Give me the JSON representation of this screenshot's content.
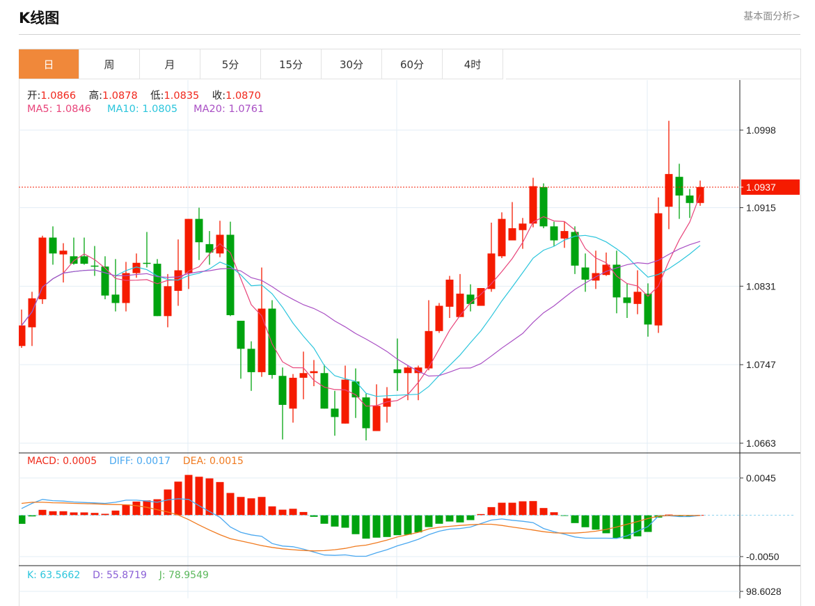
{
  "header": {
    "title": "K线图",
    "link": "基本面分析>"
  },
  "tabs": [
    {
      "label": "日",
      "active": true
    },
    {
      "label": "周"
    },
    {
      "label": "月"
    },
    {
      "label": "5分"
    },
    {
      "label": "15分"
    },
    {
      "label": "30分"
    },
    {
      "label": "60分"
    },
    {
      "label": "4时"
    }
  ],
  "ohlc_legend": {
    "open_label": "开:",
    "open": "1.0866",
    "high_label": "高:",
    "high": "1.0878",
    "low_label": "低:",
    "low": "1.0835",
    "close_label": "收:",
    "close": "1.0870"
  },
  "ma_legend": {
    "ma5_label": "MA5:",
    "ma5": "1.0846",
    "ma10_label": "MA10:",
    "ma10": "1.0805",
    "ma20_label": "MA20:",
    "ma20": "1.0761"
  },
  "macd_legend": {
    "macd": "MACD: 0.0005",
    "diff": "DIFF: 0.0017",
    "dea": "DEA: 0.0015"
  },
  "kdj_legend": {
    "k": "K: 63.5662",
    "d": "D: 55.8719",
    "j": "J: 78.9549"
  },
  "colors": {
    "up": "#f51b00",
    "down": "#00a30f",
    "ma5": "#e8447a",
    "ma10": "#2bc5dc",
    "ma20": "#a94fc4",
    "diff": "#4aa8f0",
    "dea": "#f07a1f",
    "accent": "#f0883a"
  },
  "chart_data": {
    "type": "candlestick",
    "price_axis": {
      "ticks": [
        "1.0998",
        "1.0915",
        "1.0831",
        "1.0747",
        "1.0663"
      ],
      "range": [
        1.0663,
        1.0998
      ]
    },
    "last_price": "1.0937",
    "candles_ohlc": [
      [
        1.0767,
        1.0806,
        1.0765,
        1.0789
      ],
      [
        1.0787,
        1.0825,
        1.0767,
        1.0818
      ],
      [
        1.0817,
        1.0885,
        1.0812,
        1.0883
      ],
      [
        1.0883,
        1.0895,
        1.0854,
        1.0866
      ],
      [
        1.0865,
        1.0877,
        1.0835,
        1.0869
      ],
      [
        1.0863,
        1.0883,
        1.0854,
        1.0855
      ],
      [
        1.0863,
        1.0883,
        1.0854,
        1.0855
      ],
      [
        1.0853,
        1.0874,
        1.0842,
        1.0852
      ],
      [
        1.0852,
        1.0863,
        1.0817,
        1.0821
      ],
      [
        1.0822,
        1.086,
        1.0804,
        1.0813
      ],
      [
        1.0813,
        1.0857,
        1.0804,
        1.0845
      ],
      [
        1.0845,
        1.0866,
        1.084,
        1.0856
      ],
      [
        1.0856,
        1.0889,
        1.0851,
        1.0855
      ],
      [
        1.0855,
        1.086,
        1.0799,
        1.0799
      ],
      [
        1.0799,
        1.0844,
        1.0787,
        1.0831
      ],
      [
        1.0826,
        1.0881,
        1.081,
        1.0848
      ],
      [
        1.0845,
        1.0903,
        1.0828,
        1.0903
      ],
      [
        1.0903,
        1.0915,
        1.0859,
        1.0878
      ],
      [
        1.0876,
        1.089,
        1.0854,
        1.0867
      ],
      [
        1.0866,
        1.0901,
        1.0862,
        1.0886
      ],
      [
        1.0886,
        1.09,
        1.0799,
        1.08
      ],
      [
        1.0794,
        1.0794,
        1.0732,
        1.0764
      ],
      [
        1.0764,
        1.0772,
        1.0719,
        1.0739
      ],
      [
        1.0739,
        1.0851,
        1.0734,
        1.0807
      ],
      [
        1.0807,
        1.0816,
        1.0732,
        1.0736
      ],
      [
        1.0735,
        1.0744,
        1.0667,
        1.0704
      ],
      [
        1.07,
        1.0737,
        1.0685,
        1.0733
      ],
      [
        1.0733,
        1.0761,
        1.071,
        1.0738
      ],
      [
        1.0738,
        1.0752,
        1.0724,
        1.074
      ],
      [
        1.0738,
        1.0747,
        1.07,
        1.07
      ],
      [
        1.07,
        1.0719,
        1.0671,
        1.0691
      ],
      [
        1.0684,
        1.0746,
        1.0684,
        1.0731
      ],
      [
        1.0729,
        1.0743,
        1.069,
        1.0712
      ],
      [
        1.0712,
        1.0716,
        1.0666,
        1.0679
      ],
      [
        1.0676,
        1.0726,
        1.0676,
        1.0703
      ],
      [
        1.0702,
        1.0723,
        1.0685,
        1.0711
      ],
      [
        1.0742,
        1.0775,
        1.0719,
        1.0738
      ],
      [
        1.0738,
        1.0746,
        1.0709,
        1.0744
      ],
      [
        1.0738,
        1.0746,
        1.0709,
        1.0744
      ],
      [
        1.0743,
        1.0816,
        1.0741,
        1.0783
      ],
      [
        1.0783,
        1.0813,
        1.0781,
        1.081
      ],
      [
        1.0809,
        1.0842,
        1.0797,
        1.0838
      ],
      [
        1.0798,
        1.0844,
        1.0798,
        1.0823
      ],
      [
        1.0822,
        1.0833,
        1.0804,
        1.0812
      ],
      [
        1.081,
        1.0829,
        1.081,
        1.0829
      ],
      [
        1.0828,
        1.0899,
        1.0825,
        1.0866
      ],
      [
        1.0863,
        1.091,
        1.0861,
        1.0903
      ],
      [
        1.088,
        1.0921,
        1.088,
        1.0893
      ],
      [
        1.0891,
        1.0904,
        1.0871,
        1.0898
      ],
      [
        1.0898,
        1.0947,
        1.0894,
        1.0938
      ],
      [
        1.0937,
        1.0941,
        1.0893,
        1.0895
      ],
      [
        1.0895,
        1.09,
        1.0874,
        1.088
      ],
      [
        1.0882,
        1.09,
        1.0872,
        1.089
      ],
      [
        1.0889,
        1.0895,
        1.0844,
        1.0853
      ],
      [
        1.0851,
        1.0866,
        1.0825,
        1.0838
      ],
      [
        1.0837,
        1.0869,
        1.0828,
        1.0845
      ],
      [
        1.0843,
        1.0867,
        1.0842,
        1.0854
      ],
      [
        1.0854,
        1.0869,
        1.0802,
        1.0819
      ],
      [
        1.0819,
        1.0834,
        1.0797,
        1.0813
      ],
      [
        1.0812,
        1.0848,
        1.0801,
        1.0825
      ],
      [
        1.0823,
        1.0834,
        1.0777,
        1.079
      ],
      [
        1.0789,
        1.0926,
        1.0781,
        1.0909
      ],
      [
        1.0916,
        1.1008,
        1.0892,
        1.0951
      ],
      [
        1.0948,
        1.0962,
        1.0903,
        1.0928
      ],
      [
        1.0928,
        1.0935,
        1.0904,
        1.092
      ],
      [
        1.092,
        1.0944,
        1.0917,
        1.0937
      ]
    ],
    "macd_axis": {
      "ticks": [
        "0.0045",
        "-0.0050"
      ],
      "range": [
        -0.005,
        0.0045
      ],
      "unit": 0.0001
    },
    "macd": [
      -10.4,
      -1.4,
      6.5,
      4.8,
      4.8,
      3.4,
      3.4,
      2.8,
      1.7,
      5.6,
      12.9,
      16.5,
      17.9,
      19.3,
      31.1,
      40.6,
      48.7,
      46.5,
      44.5,
      40.1,
      26.9,
      22.1,
      20.4,
      22.1,
      10.7,
      6.7,
      7.8,
      3.9,
      -1.9,
      -10.3,
      -13.7,
      -15.1,
      -22.9,
      -28.3,
      -27.1,
      -26.3,
      -24.1,
      -23.5,
      -20.7,
      -14.3,
      -10.3,
      -7.6,
      -8.7,
      -5.9,
      1.4,
      9.8,
      15.1,
      15.1,
      16.8,
      17.1,
      8.7,
      3.6,
      -0.8,
      -9.5,
      -14.5,
      -17.4,
      -21.8,
      -27.7,
      -28.6,
      -25.5,
      -20.2,
      -2.8,
      0.8,
      -1.4,
      -1.7,
      0.3
    ],
    "diff": [
      8.1,
      14.3,
      19.1,
      17.6,
      17.1,
      16.0,
      15.4,
      14.9,
      14.3,
      15.7,
      18.2,
      18.2,
      17.1,
      15.7,
      18.5,
      19.9,
      19.1,
      11.5,
      4.5,
      -2.5,
      -14.3,
      -20.7,
      -23.8,
      -25.5,
      -34.2,
      -37.2,
      -38.1,
      -40.9,
      -44.5,
      -48.1,
      -48.5,
      -47.9,
      -49.6,
      -49.6,
      -45.4,
      -41.7,
      -37.0,
      -33.3,
      -29.1,
      -23.5,
      -19.3,
      -16.8,
      -16.0,
      -14.3,
      -10.1,
      -5.9,
      -4.5,
      -6.1,
      -7.3,
      -9.0,
      -16.0,
      -19.9,
      -22.9,
      -26.3,
      -27.7,
      -27.7,
      -27.7,
      -28.0,
      -24.9,
      -19.3,
      -13.7,
      -1.1,
      -0.6,
      -1.7,
      -1.7,
      -0.3
    ],
    "dea": [
      14.3,
      15.7,
      15.7,
      15.1,
      14.9,
      14.3,
      14.0,
      13.7,
      13.2,
      12.9,
      12.6,
      11.5,
      9.5,
      6.7,
      3.9,
      0.3,
      -5.3,
      -11.8,
      -17.9,
      -23.5,
      -28.3,
      -31.1,
      -33.9,
      -36.7,
      -38.9,
      -40.6,
      -41.7,
      -42.6,
      -43.1,
      -42.8,
      -41.7,
      -40.1,
      -37.5,
      -36.1,
      -33.3,
      -30.0,
      -26.3,
      -23.5,
      -20.7,
      -16.5,
      -14.5,
      -13.4,
      -12.3,
      -11.5,
      -10.9,
      -10.9,
      -12.3,
      -14.3,
      -16.0,
      -17.9,
      -19.9,
      -21.3,
      -21.6,
      -21.6,
      -20.7,
      -19.3,
      -17.1,
      -14.3,
      -10.9,
      -7.6,
      -3.9,
      -1.1,
      -0.3,
      -0.3,
      -0.3,
      -0.3
    ],
    "kdj_axis": {
      "ticks": [
        "98.6028"
      ]
    }
  }
}
